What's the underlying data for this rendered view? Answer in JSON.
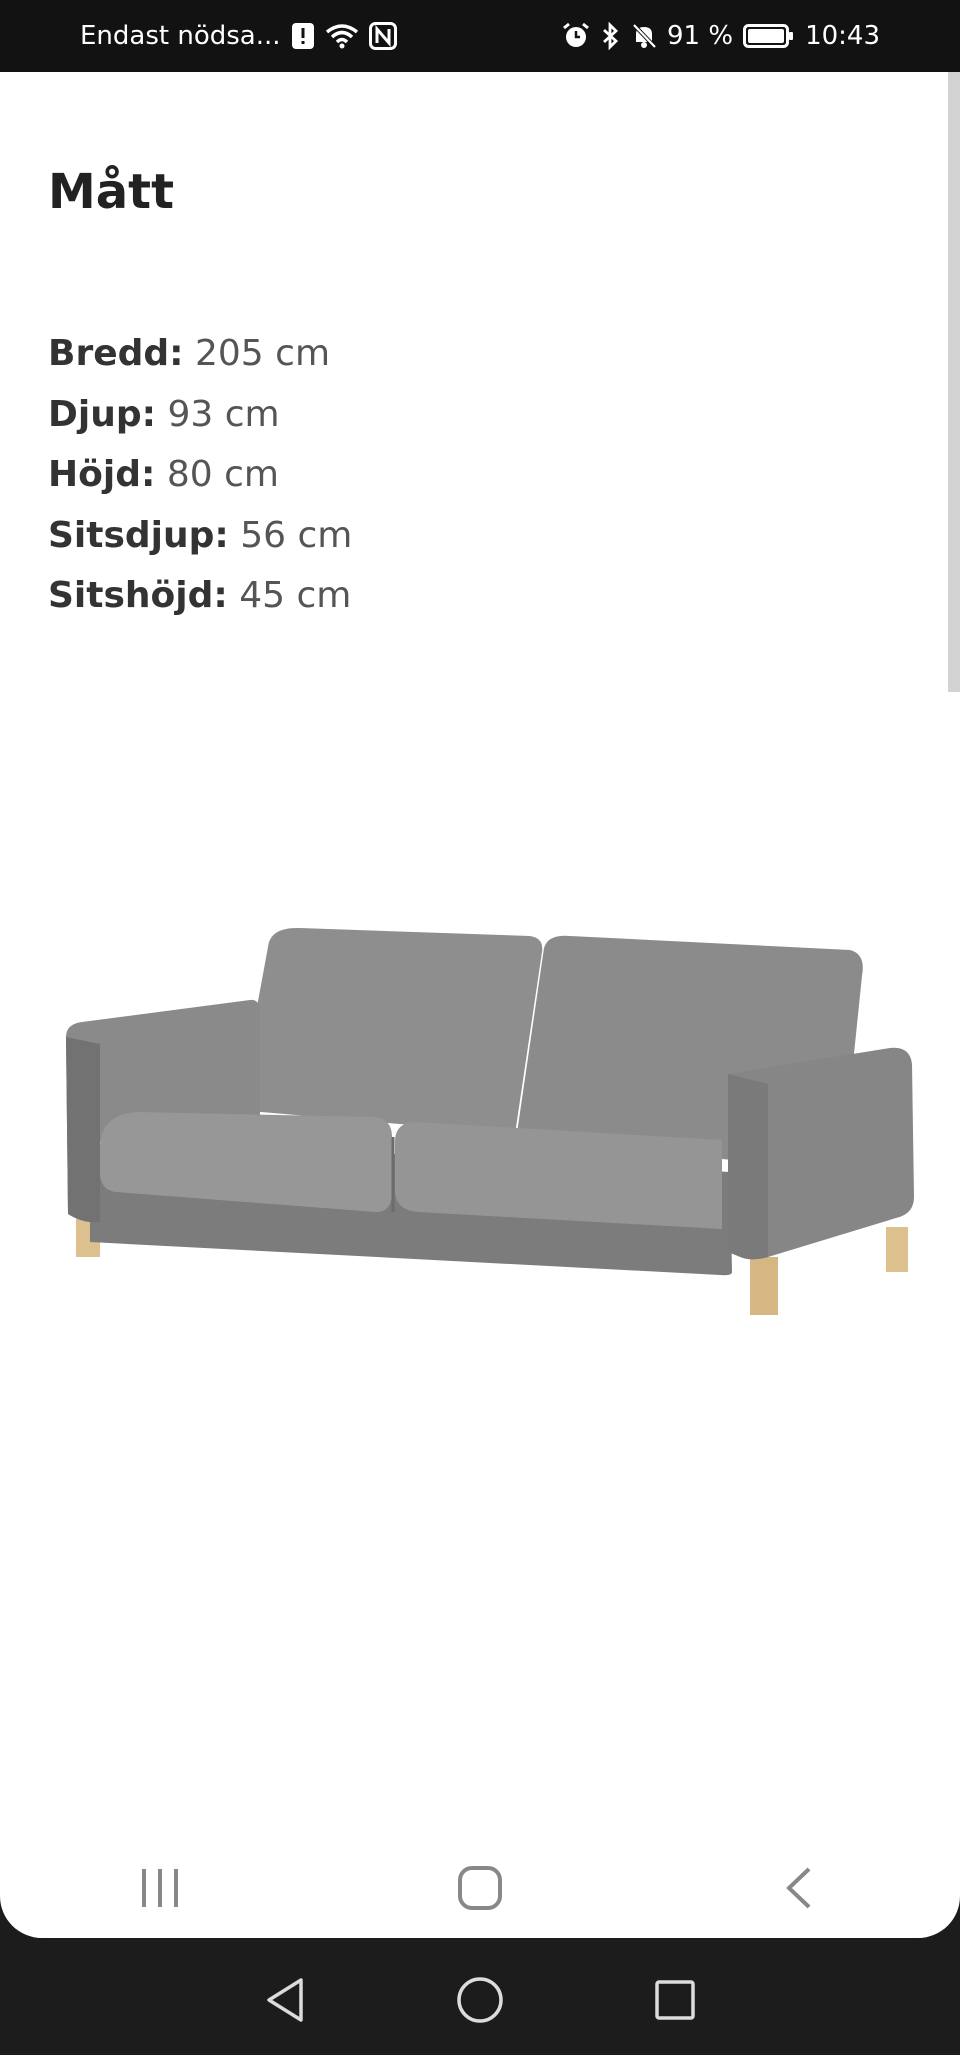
{
  "status_bar": {
    "carrier": "Endast nödsa...",
    "battery_percent": "91 %",
    "time": "10:43",
    "icons": [
      "alert-icon",
      "wifi-icon",
      "nfc-icon",
      "alarm-icon",
      "bluetooth-icon",
      "mute-icon",
      "battery-icon"
    ]
  },
  "page": {
    "title": "Mått",
    "dimensions": [
      {
        "label": "Bredd:",
        "value": " 205 cm"
      },
      {
        "label": "Djup:",
        "value": " 93 cm"
      },
      {
        "label": "Höjd:",
        "value": " 80 cm"
      },
      {
        "label": "Sitsdjup:",
        "value": " 56 cm"
      },
      {
        "label": "Sitshöjd:",
        "value": " 45 cm"
      }
    ],
    "image": "grey-three-seat-sofa"
  },
  "app_nav": [
    "recent-apps-icon",
    "home-icon",
    "back-chevron-icon"
  ],
  "system_nav": [
    "back-triangle-icon",
    "home-circle-icon",
    "recents-square-icon"
  ]
}
